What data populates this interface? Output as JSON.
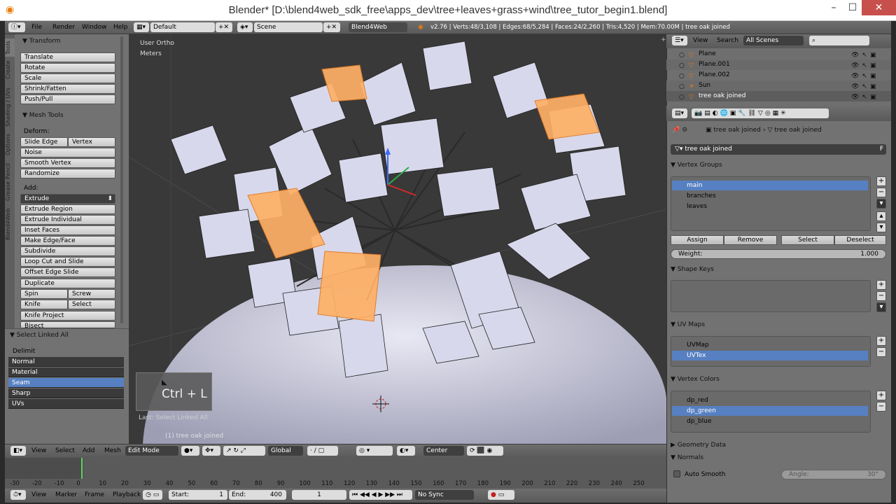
{
  "window": {
    "title": "Blender* [D:\\blend4web_sdk_free\\apps_dev\\tree+leaves+grass+wind\\tree_tutor_begin1.blend]",
    "minimize": "–",
    "maximize": "☐",
    "close": "✕"
  },
  "infobar": {
    "menus": [
      "File",
      "Render",
      "Window",
      "Help"
    ],
    "layout": "Default",
    "scene": "Scene",
    "engine": "Blend4Web",
    "stats": "v2.76 | Verts:48/3,108 | Edges:68/5,284 | Faces:24/2,260 | Tris:4,520 | Mem:70.00M | tree oak joined"
  },
  "toolshelf": {
    "tabs": [
      "Tools",
      "Create",
      "Shading / UVs",
      "Options",
      "Grease Pencil",
      "Blend4Web"
    ],
    "transform_header": "Transform",
    "transform_buttons": [
      "Translate",
      "Rotate",
      "Scale",
      "Shrink/Fatten",
      "Push/Pull"
    ],
    "mesh_tools_header": "Mesh Tools",
    "deform_label": "Deform:",
    "slide_edge": "Slide Edge",
    "vertex": "Vertex",
    "deform_buttons": [
      "Noise",
      "Smooth Vertex",
      "Randomize"
    ],
    "add_label": "Add:",
    "extrude": "Extrude",
    "add_buttons": [
      "Extrude Region",
      "Extrude Individual",
      "Inset Faces",
      "Make Edge/Face",
      "Subdivide",
      "Loop Cut and Slide",
      "Offset Edge Slide",
      "Duplicate"
    ],
    "spin": "Spin",
    "screw": "Screw",
    "knife": "Knife",
    "select": "Select",
    "knife_project": "Knife Project",
    "bisect": "Bisect"
  },
  "redo_panel": {
    "header": "Select Linked All",
    "delimit_label": "Delimit",
    "options": [
      {
        "label": "Normal",
        "selected": false
      },
      {
        "label": "Material",
        "selected": false
      },
      {
        "label": "Seam",
        "selected": true
      },
      {
        "label": "Sharp",
        "selected": false
      },
      {
        "label": "UVs",
        "selected": false
      }
    ]
  },
  "viewport": {
    "view_name": "User Ortho",
    "units": "Meters",
    "shortcut_overlay": "Ctrl + L",
    "last_op": "Last: Select Linked All",
    "object_label": "(1) tree oak joined"
  },
  "header3d": {
    "menus": [
      "View",
      "Select",
      "Add",
      "Mesh"
    ],
    "mode": "Edit Mode",
    "orientation": "Global",
    "pivot": "Center"
  },
  "timeline": {
    "ticks": [
      "-30",
      "-20",
      "-10",
      "0",
      "10",
      "20",
      "30",
      "40",
      "50",
      "60",
      "70",
      "80",
      "90",
      "100",
      "110",
      "120",
      "130",
      "140",
      "150",
      "160",
      "170",
      "180",
      "190",
      "200",
      "210",
      "220",
      "230",
      "240",
      "250"
    ],
    "current_frame": 0,
    "menus": [
      "View",
      "Marker",
      "Frame",
      "Playback"
    ],
    "start_label": "Start:",
    "start_value": "1",
    "end_label": "End:",
    "end_value": "400",
    "current_value": "1",
    "sync": "No Sync"
  },
  "outliner": {
    "menus": [
      "View",
      "Search"
    ],
    "scope": "All Scenes",
    "rows": [
      {
        "name": "Plane",
        "selected": false
      },
      {
        "name": "Plane.001",
        "selected": false
      },
      {
        "name": "Plane.002",
        "selected": false
      },
      {
        "name": "Sun",
        "selected": false
      },
      {
        "name": "tree oak joined",
        "selected": true
      }
    ]
  },
  "properties": {
    "breadcrumb_1": "tree oak joined",
    "breadcrumb_2": "tree oak joined",
    "mesh_name": "tree oak joined",
    "fake_user": "F",
    "vertex_groups_header": "Vertex Groups",
    "vertex_groups": [
      {
        "name": "main",
        "selected": true
      },
      {
        "name": "branches",
        "selected": false
      },
      {
        "name": "leaves",
        "selected": false
      }
    ],
    "assign": "Assign",
    "remove": "Remove",
    "select": "Select",
    "deselect": "Deselect",
    "weight_label": "Weight:",
    "weight_value": "1.000",
    "shape_keys_header": "Shape Keys",
    "uv_maps_header": "UV Maps",
    "uv_maps": [
      {
        "name": "UVMap",
        "selected": false
      },
      {
        "name": "UVTex",
        "selected": true
      }
    ],
    "vertex_colors_header": "Vertex Colors",
    "vertex_colors": [
      {
        "name": "dp_red",
        "selected": false
      },
      {
        "name": "dp_green",
        "selected": true
      },
      {
        "name": "dp_blue",
        "selected": false
      }
    ],
    "geometry_data_header": "Geometry Data",
    "normals_header": "Normals",
    "auto_smooth": "Auto Smooth",
    "angle_label": "Angle:",
    "angle_value": "30°"
  },
  "colors": {
    "selection_blue": "#5680c2",
    "seam_orange": "#ffb066",
    "leaf_face": "#d8d8ec"
  }
}
